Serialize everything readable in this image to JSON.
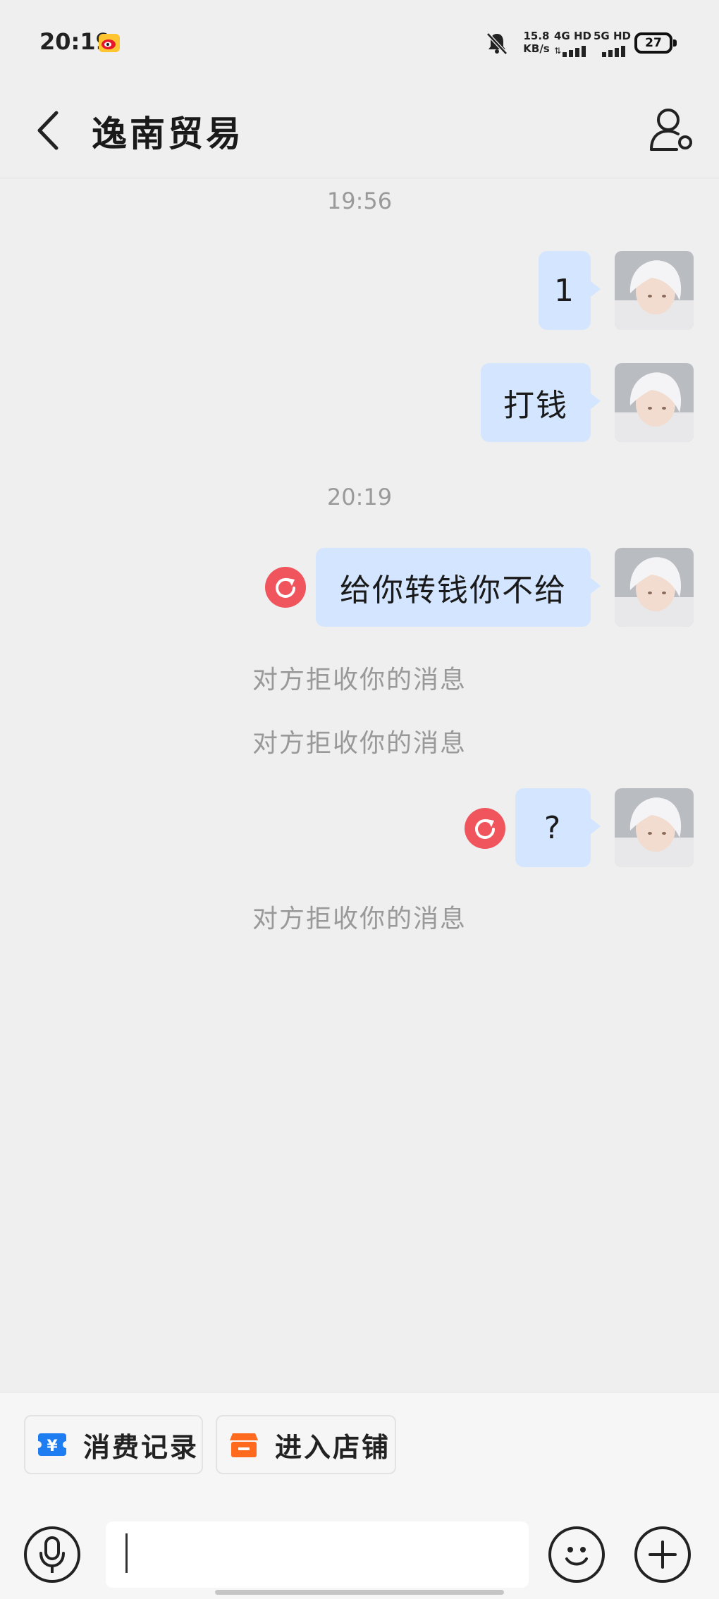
{
  "status_bar": {
    "time": "20:19",
    "net_speed_value": "15.8",
    "net_speed_unit": "KB/s",
    "signal_1_label": "4G HD",
    "signal_2_label": "5G HD",
    "battery": "27"
  },
  "header": {
    "title": "逸南贸易"
  },
  "messages": {
    "timestamp_1": "19:56",
    "msg_1": "1",
    "msg_2": "打钱",
    "timestamp_2": "20:19",
    "msg_3": "给你转钱你不给",
    "system_1": "对方拒收你的消息",
    "system_2": "对方拒收你的消息",
    "msg_4": "?",
    "system_3": "对方拒收你的消息"
  },
  "quick_actions": {
    "records_label": "消费记录",
    "store_label": "进入店铺"
  },
  "colors": {
    "bubble": "#d4e6ff",
    "retry": "#f0555d",
    "records_icon": "#1e7df0",
    "store_icon": "#ff6a1e"
  }
}
